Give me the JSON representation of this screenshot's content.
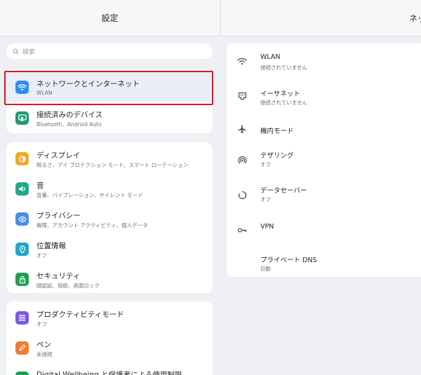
{
  "header": {
    "left_title": "設定",
    "right_title": "ネッ"
  },
  "search": {
    "placeholder": "検索"
  },
  "colors": {
    "highlight": "#e3131b",
    "selected_bg": "#e9eef9"
  },
  "left_groups": [
    {
      "items": [
        {
          "title": "ネットワークとインターネット",
          "subtitle": "WLAN",
          "icon": "wifi-icon",
          "color": "#2f8cf0",
          "selected": true
        },
        {
          "title": "接続済みのデバイス",
          "subtitle": "Bluetooth、Android Auto",
          "icon": "connected-devices-icon",
          "color": "#1f9c6e"
        }
      ]
    },
    {
      "items": [
        {
          "title": "ディスプレイ",
          "subtitle": "明るさ、アイ プロテクション モード、スマート ローテーション",
          "icon": "display-icon",
          "color": "#f5a623"
        },
        {
          "title": "音",
          "subtitle": "音量、バイブレーション、サイレント モード",
          "icon": "sound-icon",
          "color": "#1fa88c"
        },
        {
          "title": "プライバシー",
          "subtitle": "権限、アカウント アクティビティ、個人データ",
          "icon": "privacy-icon",
          "color": "#4a8fe7"
        },
        {
          "title": "位置情報",
          "subtitle": "オフ",
          "icon": "location-icon",
          "color": "#20a7c9"
        },
        {
          "title": "セキュリティ",
          "subtitle": "顔認証、指紋、画面ロック",
          "icon": "lock-icon",
          "color": "#1f9c52"
        }
      ]
    },
    {
      "items": [
        {
          "title": "プロダクティビティモード",
          "subtitle": "オフ",
          "icon": "productivity-icon",
          "color": "#7b5be0"
        },
        {
          "title": "ペン",
          "subtitle": "未接続",
          "icon": "pen-icon",
          "color": "#f07b32"
        },
        {
          "title": "Digital Wellbeing と保護者による使用制限",
          "subtitle": "",
          "icon": "wellbeing-icon",
          "color": "#1f9c52"
        }
      ]
    }
  ],
  "right_items": [
    {
      "title": "WLAN",
      "subtitle": "接続されていません",
      "icon": "wifi-outline-icon"
    },
    {
      "title": "イーサネット",
      "subtitle": "接続されていません",
      "icon": "ethernet-icon"
    },
    {
      "title": "機内モード",
      "subtitle": "",
      "icon": "airplane-icon"
    },
    {
      "title": "テザリング",
      "subtitle": "オフ",
      "icon": "hotspot-icon"
    },
    {
      "title": "データセーバー",
      "subtitle": "オフ",
      "icon": "data-saver-icon"
    },
    {
      "title": "VPN",
      "subtitle": "",
      "icon": "vpn-icon"
    },
    {
      "title": "プライベート DNS",
      "subtitle": "自動",
      "icon": ""
    }
  ]
}
